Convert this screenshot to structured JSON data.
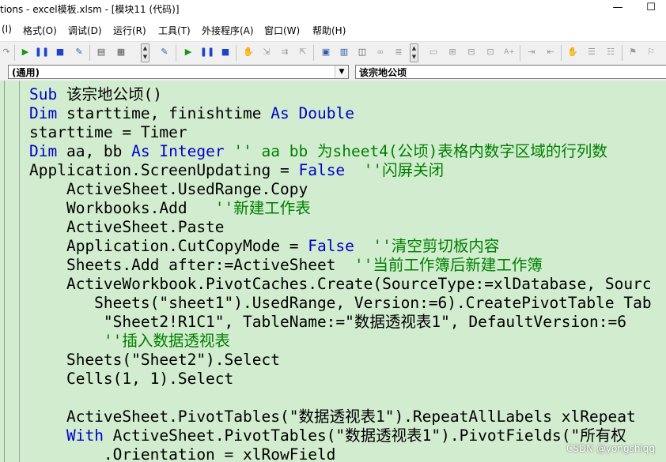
{
  "window": {
    "title": "tions - excel模板.xlsm - [模块11 (代码)]",
    "controls": [
      "—",
      "☐"
    ]
  },
  "menu": [
    {
      "label": "(I)"
    },
    {
      "label": "格式(O)"
    },
    {
      "label": "调试(D)"
    },
    {
      "label": "运行(R)"
    },
    {
      "label": "工具(T)"
    },
    {
      "label": "外接程序(A)"
    },
    {
      "label": "窗口(W)"
    },
    {
      "label": "帮助(H)"
    }
  ],
  "object_combo": {
    "value": "(通用)"
  },
  "procedure_combo": {
    "value": "该宗地公顷"
  },
  "code": [
    [
      {
        "t": "Sub",
        "c": "kw"
      },
      {
        "t": " 该宗地公顷()"
      }
    ],
    [
      {
        "t": "Dim",
        "c": "kw"
      },
      {
        "t": " starttime, finishtime "
      },
      {
        "t": "As",
        "c": "kw"
      },
      {
        "t": " "
      },
      {
        "t": "Double",
        "c": "kw"
      }
    ],
    [
      {
        "t": "starttime = Timer"
      }
    ],
    [
      {
        "t": "Dim",
        "c": "kw"
      },
      {
        "t": " aa, bb "
      },
      {
        "t": "As",
        "c": "kw"
      },
      {
        "t": " "
      },
      {
        "t": "Integer",
        "c": "kw"
      },
      {
        "t": " '' aa bb 为sheet4(公顷)表格内数字区域的行列数",
        "c": "cm"
      }
    ],
    [
      {
        "t": "Application.ScreenUpdating = "
      },
      {
        "t": "False",
        "c": "kw"
      },
      {
        "t": "  ''闪屏关闭",
        "c": "cm"
      }
    ],
    [
      {
        "t": "    ActiveSheet.UsedRange.Copy"
      }
    ],
    [
      {
        "t": "    Workbooks.Add  "
      },
      {
        "t": " ''新建工作表",
        "c": "cm"
      }
    ],
    [
      {
        "t": "    ActiveSheet.Paste"
      }
    ],
    [
      {
        "t": "    Application.CutCopyMode = "
      },
      {
        "t": "False",
        "c": "kw"
      },
      {
        "t": "  ''清空剪切板内容",
        "c": "cm"
      }
    ],
    [
      {
        "t": "    Sheets.Add after:=ActiveSheet  "
      },
      {
        "t": "''当前工作簿后新建工作簿",
        "c": "cm"
      }
    ],
    [
      {
        "t": "    ActiveWorkbook.PivotCaches.Create(SourceType:=xlDatabase, Sourc"
      }
    ],
    [
      {
        "t": "       Sheets(\"sheet1\").UsedRange, Version:=6).CreatePivotTable Tab"
      }
    ],
    [
      {
        "t": "        \"Sheet2!R1C1\", TableName:=\"数据透视表1\", DefaultVersion:=6"
      }
    ],
    [
      {
        "t": "        ''插入数据透视表",
        "c": "cm"
      }
    ],
    [
      {
        "t": "    Sheets(\"Sheet2\").Select"
      }
    ],
    [
      {
        "t": "    Cells(1, 1).Select"
      }
    ],
    [
      {
        "t": ""
      }
    ],
    [
      {
        "t": "    ActiveSheet.PivotTables(\"数据透视表1\").RepeatAllLabels xlRepeat"
      }
    ],
    [
      {
        "t": "    "
      },
      {
        "t": "With",
        "c": "kw"
      },
      {
        "t": " ActiveSheet.PivotTables(\"数据透视表1\").PivotFields(\"所有权"
      }
    ],
    [
      {
        "t": "        .Orientation = xlRowField"
      }
    ]
  ],
  "watermark": "CSDN @yongshiqq",
  "colors": {
    "editor_background": "#d2eccf",
    "keyword": "#0000c8",
    "comment": "#008000",
    "toolbar": "#f0f0f0"
  }
}
